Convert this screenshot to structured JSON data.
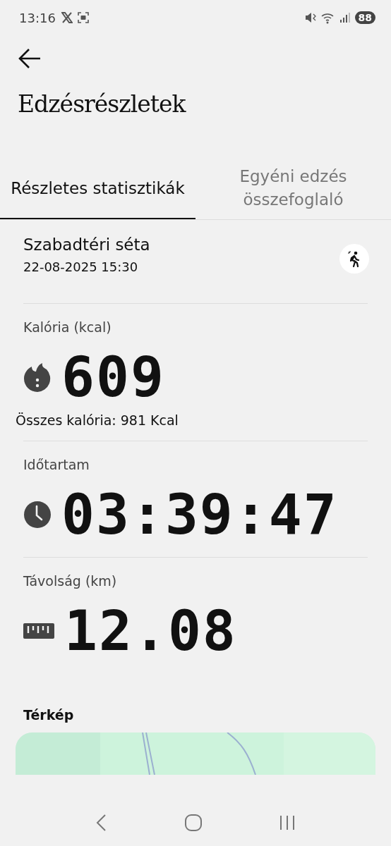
{
  "status_bar": {
    "time": "13:16",
    "battery": "88"
  },
  "header": {
    "title": "Edzésrészletek"
  },
  "tabs": [
    {
      "label": "Részletes statisztikák",
      "selected": true
    },
    {
      "label": "Egyéni edzés összefoglaló",
      "selected": false
    }
  ],
  "workout": {
    "name": "Szabadtéri séta",
    "datetime": "22-08-2025 15:30"
  },
  "metrics": [
    {
      "kind": "calories",
      "label": "Kalória (kcal)",
      "value": "609",
      "note": "Összes kalória: 981 Kcal"
    },
    {
      "kind": "duration",
      "label": "Időtartam",
      "value": "03:39:47"
    },
    {
      "kind": "distance",
      "label": "Távolság (km)",
      "value": "12.08"
    }
  ],
  "map": {
    "title": "Térkép",
    "kind": "picture"
  }
}
